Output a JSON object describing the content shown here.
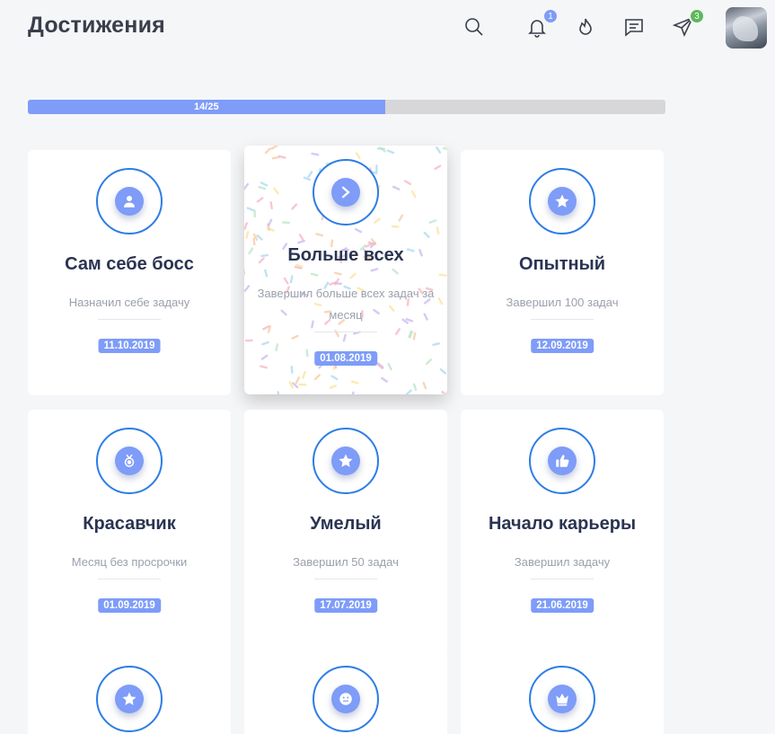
{
  "header": {
    "title": "Достижения",
    "icons": [
      {
        "name": "search-icon"
      },
      {
        "name": "bell-icon",
        "badge": "1",
        "badge_color": "#7e9cf8"
      },
      {
        "name": "fire-icon"
      },
      {
        "name": "chat-icon"
      },
      {
        "name": "send-icon",
        "badge": "3",
        "badge_color": "#5cb85c"
      }
    ]
  },
  "progress": {
    "label": "14/25",
    "completed": 14,
    "total": 25
  },
  "colors": {
    "accent": "#7e9cf8",
    "ring": "#2d7de6",
    "title": "#2a3452"
  },
  "achievements": [
    {
      "title": "Сам себе босс",
      "desc": "Назначил себе задачу",
      "date": "11.10.2019",
      "icon": "user-icon"
    },
    {
      "title": "Больше всех",
      "desc": "Завершил больше всех задач за месяц",
      "date": "01.08.2019",
      "icon": "arrow-right-icon",
      "featured": true
    },
    {
      "title": "Опытный",
      "desc": "Завершил 100 задач",
      "date": "12.09.2019",
      "icon": "star-icon"
    },
    {
      "title": "Красавчик",
      "desc": "Месяц без просрочки",
      "date": "01.09.2019",
      "icon": "medal-icon"
    },
    {
      "title": "Умелый",
      "desc": "Завершил 50 задач",
      "date": "17.07.2019",
      "icon": "star-icon"
    },
    {
      "title": "Начало карьеры",
      "desc": "Завершил задачу",
      "date": "21.06.2019",
      "icon": "thumbs-up-icon"
    },
    {
      "title": "",
      "desc": "",
      "date": "",
      "icon": "star-icon"
    },
    {
      "title": "",
      "desc": "",
      "date": "",
      "icon": "smiley-icon"
    },
    {
      "title": "",
      "desc": "",
      "date": "",
      "icon": "crown-icon"
    }
  ]
}
